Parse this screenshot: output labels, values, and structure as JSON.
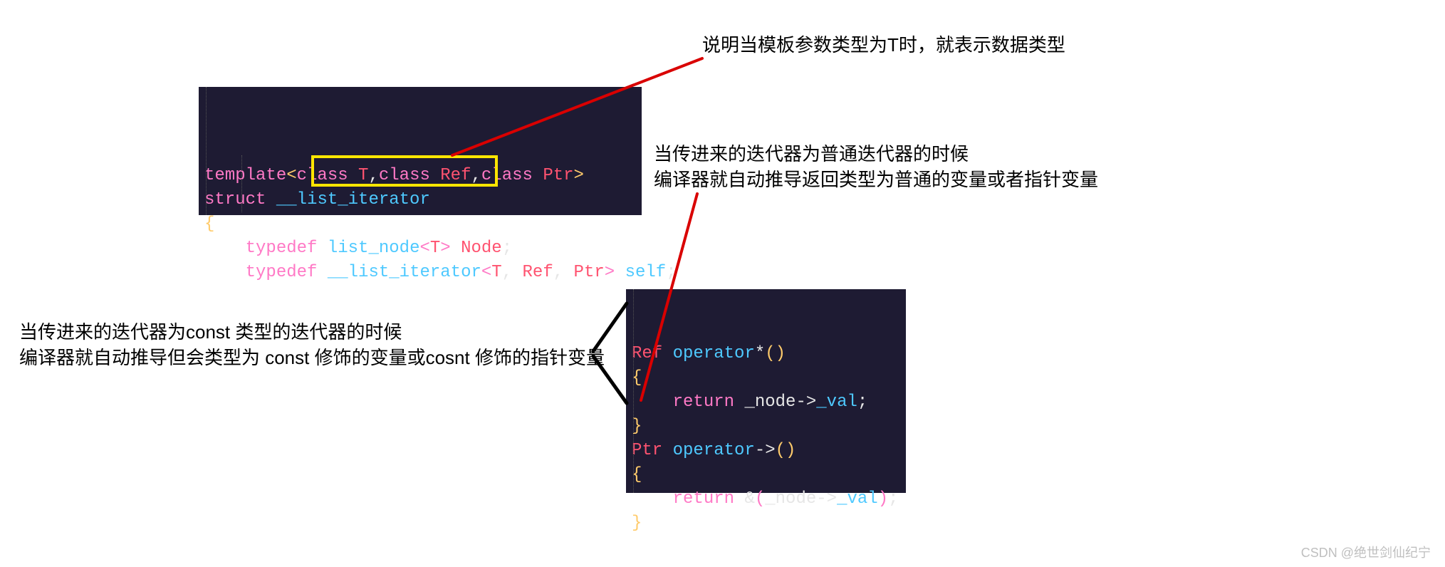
{
  "annotations": {
    "top": "说明当模板参数类型为T时，就表示数据类型",
    "right": "当传进来的迭代器为普通迭代器的时候\n编译器就自动推导返回类型为普通的变量或者指针变量",
    "left": "当传进来的迭代器为const 类型的迭代器的时候\n编译器就自动推导但会类型为 const 修饰的变量或cosnt 修饰的指针变量"
  },
  "code": {
    "top_block": {
      "l1": {
        "template": "template",
        "lt": "<",
        "class1": "class",
        "sp1": " ",
        "T": "T",
        "c1": ",",
        "class2": "class",
        "sp2": " ",
        "Ref": "Ref",
        "c2": ",",
        "class3": "class",
        "sp3": " ",
        "Ptr": "Ptr",
        "gt": ">"
      },
      "l2": {
        "struct": "struct",
        "sp": " ",
        "name": "__list_iterator"
      },
      "l3": {
        "brace": "{"
      },
      "l4": {
        "indent": "    ",
        "typedef": "typedef",
        "sp1": " ",
        "list_node": "list_node",
        "lt": "<",
        "T": "T",
        "gt": ">",
        "sp2": " ",
        "Node": "Node",
        "semi": ";"
      },
      "l5": {
        "indent": "    ",
        "typedef": "typedef",
        "sp1": " ",
        "iter": "__list_iterator",
        "lt": "<",
        "T": "T",
        "c1": ", ",
        "Ref": "Ref",
        "c2": ", ",
        "Ptr": "Ptr",
        "gt": ">",
        "sp2": " ",
        "self": "self",
        "semi": ";"
      }
    },
    "right_block": {
      "l1": {
        "Ref": "Ref",
        "sp": " ",
        "op": "operator",
        "sym": "*",
        "paren": "()"
      },
      "l2": {
        "brace": "{"
      },
      "l3": {
        "indent": "    ",
        "ret": "return",
        "sp": " ",
        "node": "_node",
        "arrow": "->",
        "val": "_val",
        "semi": ";"
      },
      "l4": {
        "brace": "}"
      },
      "l5": {
        "Ptr": "Ptr",
        "sp": " ",
        "op": "operator",
        "sym": "->",
        "paren": "()"
      },
      "l6": {
        "brace": "{"
      },
      "l7": {
        "indent": "    ",
        "ret": "return",
        "sp": " ",
        "amp": "&",
        "lp": "(",
        "node": "_node",
        "arrow": "->",
        "val": "_val",
        "rp": ")",
        "semi": ";"
      },
      "l8": {
        "brace": "}"
      }
    }
  },
  "watermark": "CSDN @绝世剑仙纪宁"
}
